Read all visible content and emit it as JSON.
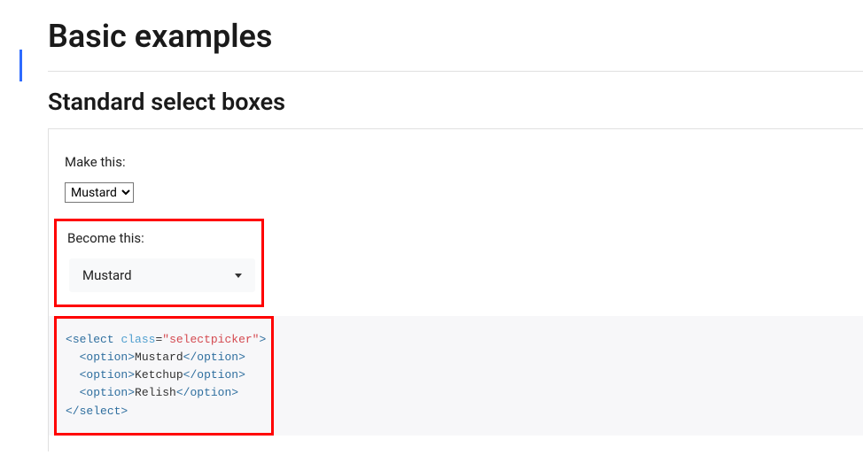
{
  "heading": "Basic examples",
  "subheading": "Standard select boxes",
  "makeThis": {
    "label": "Make this:",
    "selected": "Mustard",
    "options": [
      "Mustard",
      "Ketchup",
      "Relish"
    ]
  },
  "becomeThis": {
    "label": "Become this:",
    "selected": "Mustard"
  },
  "code": {
    "selectOpen_lt": "<",
    "selectOpen_tag": "select",
    "selectOpen_sp": " ",
    "selectOpen_attrName": "class",
    "selectOpen_eq": "=",
    "selectOpen_attrValue": "\"selectpicker\"",
    "selectOpen_gt": ">",
    "option1_open_lt": "<",
    "option1_open_tag": "option",
    "option1_open_gt": ">",
    "option1_text": "Mustard",
    "option1_close_lt": "</",
    "option1_close_tag": "option",
    "option1_close_gt": ">",
    "option2_open_lt": "<",
    "option2_open_tag": "option",
    "option2_open_gt": ">",
    "option2_text": "Ketchup",
    "option2_close_lt": "</",
    "option2_close_tag": "option",
    "option2_close_gt": ">",
    "option3_open_lt": "<",
    "option3_open_tag": "option",
    "option3_open_gt": ">",
    "option3_text": "Relish",
    "option3_close_lt": "</",
    "option3_close_tag": "option",
    "option3_close_gt": ">",
    "selectClose_lt": "</",
    "selectClose_tag": "select",
    "selectClose_gt": ">"
  }
}
